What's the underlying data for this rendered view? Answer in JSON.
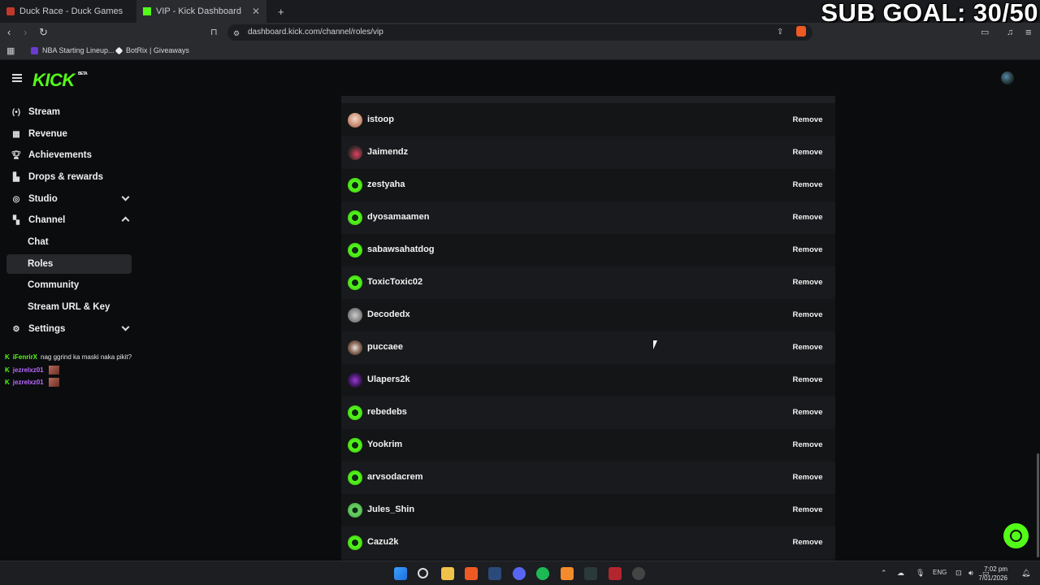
{
  "browser": {
    "tabs": [
      {
        "title": "Duck Race - Duck Games",
        "active": false
      },
      {
        "title": "VIP - Kick Dashboard",
        "active": true
      }
    ],
    "new_tab_icon": "plus-icon",
    "url": "dashboard.kick.com/channel/roles/vip",
    "bookmarks": [
      "NBA Starting Lineup...",
      "BotRix | Giveaways"
    ]
  },
  "overlay": {
    "sub_goal": "SUB GOAL: 30/50"
  },
  "header": {
    "logo": "KICK",
    "logo_badge": "BETA"
  },
  "sidebar": {
    "items": [
      {
        "label": "Stream",
        "icon": "broadcast-icon"
      },
      {
        "label": "Revenue",
        "icon": "chart-icon"
      },
      {
        "label": "Achievements",
        "icon": "trophy-icon"
      },
      {
        "label": "Drops & rewards",
        "icon": "gift-icon"
      },
      {
        "label": "Studio",
        "icon": "studio-icon"
      },
      {
        "label": "Channel",
        "icon": "channel-icon"
      },
      {
        "label": "Chat"
      },
      {
        "label": "Roles",
        "selected": true
      },
      {
        "label": "Community"
      },
      {
        "label": "Stream URL & Key"
      },
      {
        "label": "Settings",
        "icon": "gear-icon"
      }
    ]
  },
  "chat": [
    {
      "user": "iFenrirX",
      "message": "nag ggrind ka maski naka pikit?",
      "color": "#53fc18"
    },
    {
      "user": "jezrelxz01",
      "message": "",
      "color": "#b86bff"
    },
    {
      "user": "jezrelxz01",
      "message": "",
      "color": "#b86bff"
    }
  ],
  "vip_list": {
    "remove_label": "Remove",
    "users": [
      "istoop",
      "Jaimendz",
      "zestyaha",
      "dyosamaamen",
      "sabawsahatdog",
      "ToxicToxic02",
      "Decodedx",
      "puccaee",
      "Ulapers2k",
      "rebedebs",
      "Yookrim",
      "arvsodacrem",
      "Jules_Shin",
      "Cazu2k"
    ]
  },
  "taskbar": {
    "lang": "ENG",
    "time": "7:02 pm",
    "date": "7/01/2026"
  },
  "colors": {
    "brand": "#53fc18",
    "background": "#0b0c0e",
    "list_bg": "#141517"
  }
}
